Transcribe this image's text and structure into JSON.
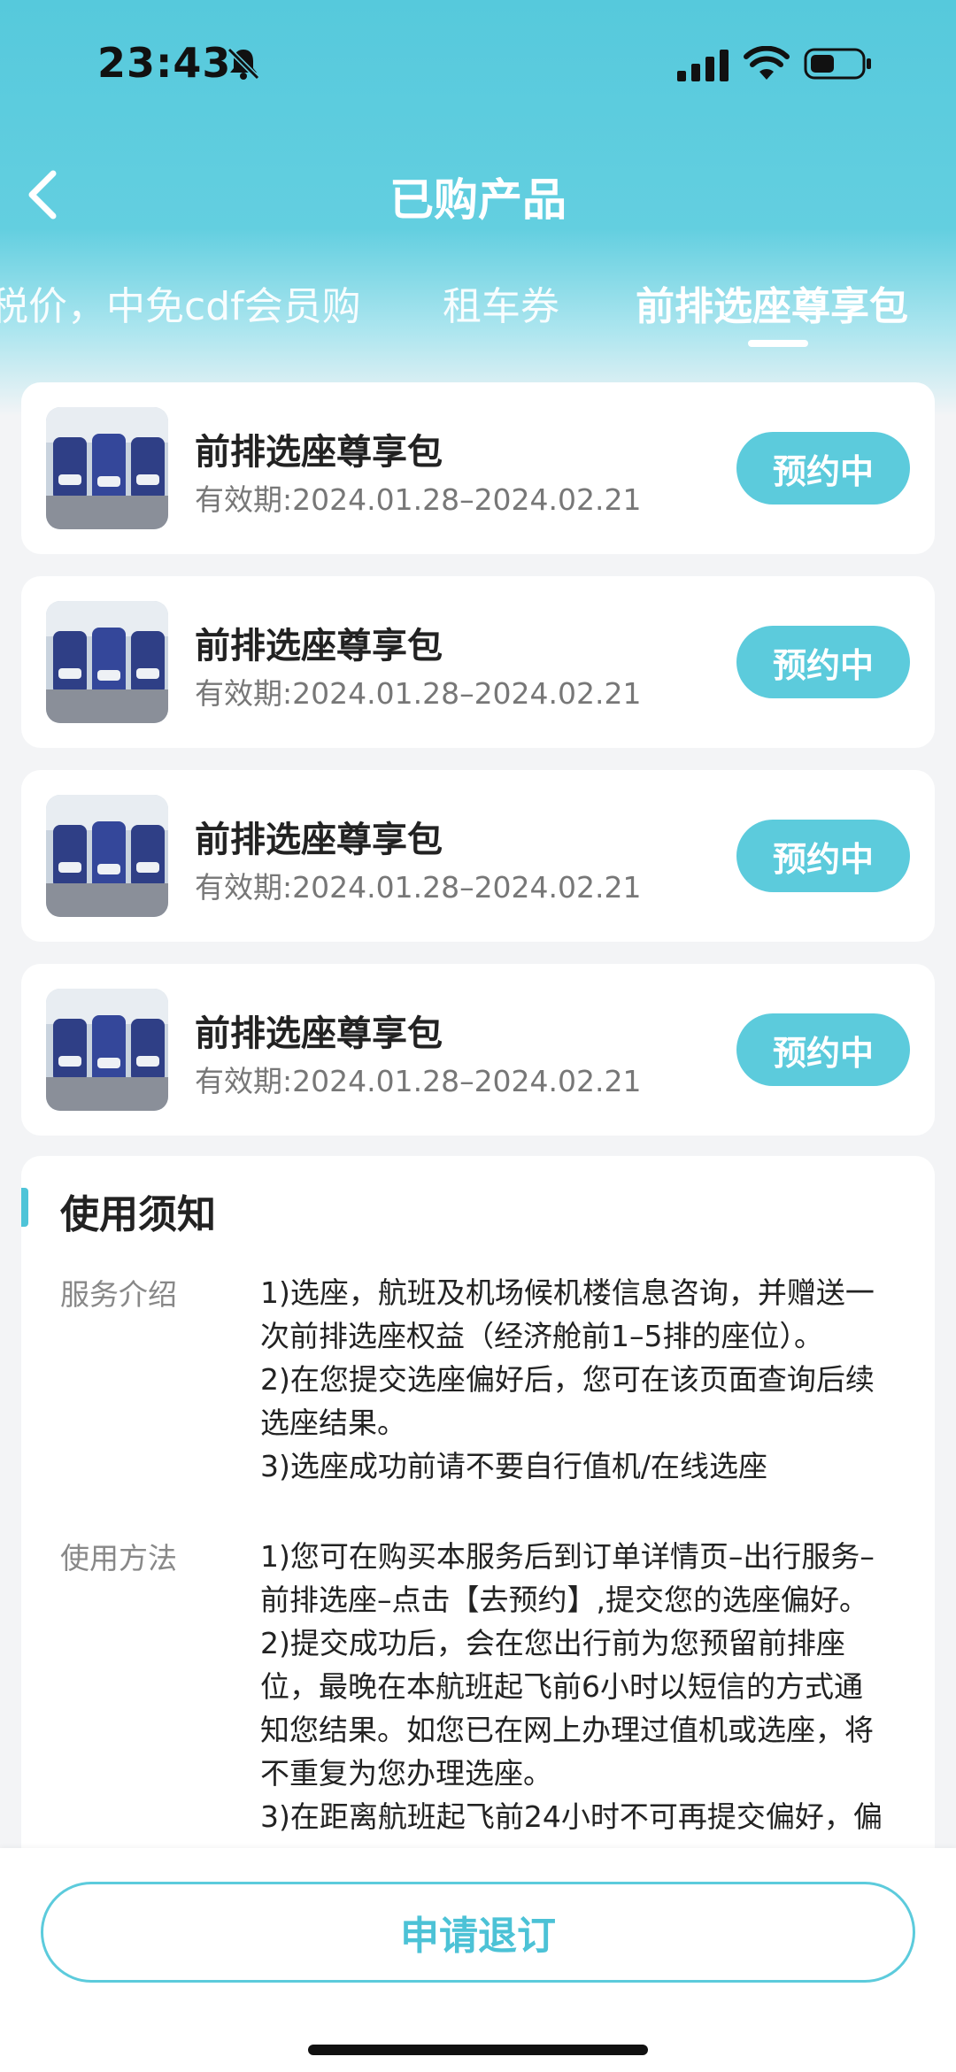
{
  "status_bar": {
    "time": "23:43",
    "icons": [
      "bell-mute-icon",
      "cellular-signal-icon",
      "wifi-icon",
      "battery-icon"
    ]
  },
  "nav": {
    "title": "已购产品",
    "back_icon": "chevron-left-icon"
  },
  "tabs": [
    {
      "label": "税价，中免cdf会员购",
      "active": false
    },
    {
      "label": "租车券",
      "active": false
    },
    {
      "label": "前排选座尊享包",
      "active": true
    }
  ],
  "products": [
    {
      "name": "前排选座尊享包",
      "validity": "有效期:2024.01.28–2024.02.21",
      "status": "预约中"
    },
    {
      "name": "前排选座尊享包",
      "validity": "有效期:2024.01.28–2024.02.21",
      "status": "预约中"
    },
    {
      "name": "前排选座尊享包",
      "validity": "有效期:2024.01.28–2024.02.21",
      "status": "预约中"
    },
    {
      "name": "前排选座尊享包",
      "validity": "有效期:2024.01.28–2024.02.21",
      "status": "预约中"
    }
  ],
  "notice": {
    "title": "使用须知",
    "sections": [
      {
        "label": "服务介绍",
        "lines": [
          "1)选座，航班及机场候机楼信息咨询，并赠送一",
          "次前排选座权益（经济舱前1–5排的座位）。",
          "2)在您提交选座偏好后，您可在该页面查询后续",
          "选座结果。",
          "3)选座成功前请不要自行值机/在线选座"
        ]
      },
      {
        "label": "使用方法",
        "lines": [
          "1)您可在购买本服务后到订单详情页–出行服务–",
          "前排选座–点击【去预约】,提交您的选座偏好。",
          "2)提交成功后，会在您出行前为您预留前排座",
          "位，最晚在本航班起飞前6小时以短信的方式通",
          "知您结果。如您已在网上办理过值机或选座，将",
          "不重复为您办理选座。",
          "3)在距离航班起飞前24小时不可再提交偏好，偏"
        ]
      }
    ]
  },
  "bottom": {
    "refund_label": "申请退订"
  },
  "colors": {
    "accent": "#5ccbdc",
    "header_top": "#56c9dc",
    "background": "#f3f4f6"
  }
}
